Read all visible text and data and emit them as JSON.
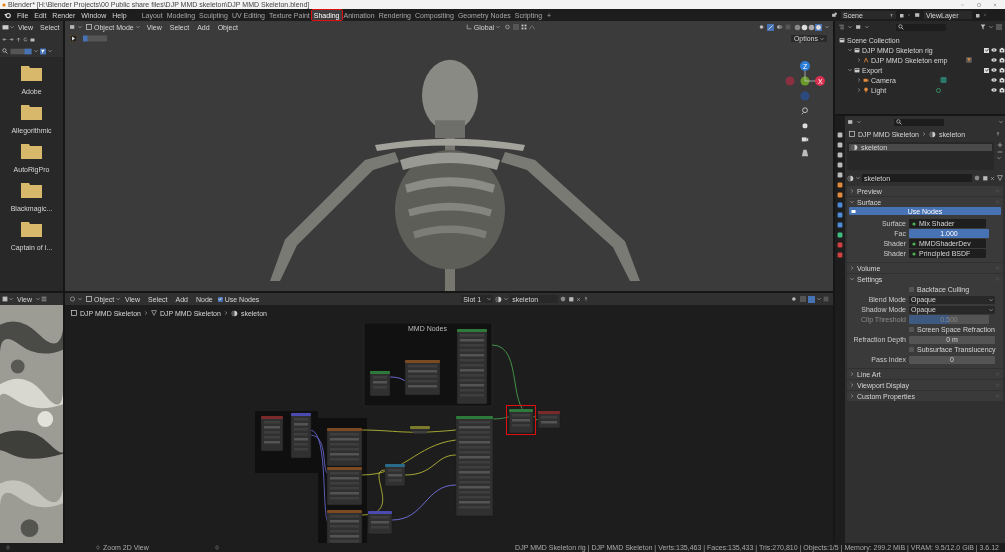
{
  "window": {
    "title": "Blender* [H:\\Blender Projects\\00 Public share files\\DJP MMD skeleton\\DJP MMD Skeleton.blend]"
  },
  "top_bar": {
    "menu": [
      "File",
      "Edit",
      "Render",
      "Window",
      "Help"
    ],
    "workspaces": [
      {
        "label": "Layout",
        "selected": false,
        "annotated": false
      },
      {
        "label": "Modeling",
        "selected": false,
        "annotated": false
      },
      {
        "label": "Sculpting",
        "selected": false,
        "annotated": false
      },
      {
        "label": "UV Editing",
        "selected": false,
        "annotated": false
      },
      {
        "label": "Texture Paint",
        "selected": false,
        "annotated": false
      },
      {
        "label": "Shading",
        "selected": true,
        "annotated": true
      },
      {
        "label": "Animation",
        "selected": false,
        "annotated": false
      },
      {
        "label": "Rendering",
        "selected": false,
        "annotated": false
      },
      {
        "label": "Compositing",
        "selected": false,
        "annotated": false
      },
      {
        "label": "Geometry Nodes",
        "selected": false,
        "annotated": false
      },
      {
        "label": "Scripting",
        "selected": false,
        "annotated": false
      }
    ],
    "add_tab": "+",
    "scene": "Scene",
    "view_layer": "ViewLayer"
  },
  "file_browser": {
    "menu": [
      "View",
      "Select"
    ],
    "folders": [
      "Adobe",
      "Allegorithmic",
      "AutoRigPro",
      "Blackmagic...",
      "Captain of I..."
    ]
  },
  "image_editor": {
    "menu": [
      "View"
    ]
  },
  "viewport": {
    "mode": "Object Mode",
    "menu": [
      "View",
      "Select",
      "Add",
      "Object"
    ],
    "orientation": "Global",
    "options": "Options",
    "gizmo": [
      "Z",
      "X"
    ]
  },
  "outliner": {
    "tree": [
      {
        "label": "Scene Collection",
        "kind": "scene",
        "children": [
          {
            "label": "DJP MMD Skeleton rig",
            "kind": "collection",
            "expanded": true,
            "checked": true,
            "children": [
              {
                "label": "DJP MMD Skeleton emp",
                "kind": "armature",
                "expanded": false
              }
            ]
          },
          {
            "label": "Export",
            "kind": "collection",
            "expanded": true,
            "checked": true,
            "children": [
              {
                "label": "Camera",
                "kind": "camera",
                "expanded": false
              },
              {
                "label": "Light",
                "kind": "light",
                "expanded": false
              }
            ]
          }
        ]
      }
    ]
  },
  "properties": {
    "breadcrumb": [
      "DJP MMD Skeleton",
      "skeleton"
    ],
    "slots": [
      {
        "label": "skeleton",
        "selected": true
      }
    ],
    "material": "skeleton",
    "panels": [
      {
        "title": "Preview",
        "expanded": false
      },
      {
        "title": "Surface",
        "expanded": true,
        "button": "Use Nodes",
        "rows": [
          {
            "kind": "socket",
            "label": "Surface",
            "value": "Mix Shader"
          },
          {
            "kind": "slider",
            "label": "Fac",
            "value": "1.000",
            "level": 1,
            "disabled": false
          },
          {
            "kind": "socket",
            "label": "Shader",
            "value": "MMDShaderDev"
          },
          {
            "kind": "socket",
            "label": "Shader",
            "value": "Principled BSDF"
          }
        ]
      },
      {
        "title": "Volume",
        "expanded": false
      },
      {
        "title": "Settings",
        "expanded": true,
        "rows": [
          {
            "kind": "checkbox",
            "label": "Backface Culling",
            "checked": false
          },
          {
            "kind": "dropdown",
            "label": "Blend Mode",
            "value": "Opaque"
          },
          {
            "kind": "dropdown",
            "label": "Shadow Mode",
            "value": "Opaque"
          },
          {
            "kind": "slider",
            "label": "Clip Threshold",
            "value": "0.500",
            "level": 0.5,
            "disabled": true
          },
          {
            "kind": "checkbox",
            "label": "Screen Space Refraction",
            "checked": false
          },
          {
            "kind": "number",
            "label": "Refraction Depth",
            "value": "0 m"
          },
          {
            "kind": "checkbox",
            "label": "Subsurface Translucency",
            "checked": false
          },
          {
            "kind": "number",
            "label": "Pass Index",
            "value": "0"
          }
        ]
      },
      {
        "title": "Line Art",
        "expanded": false
      },
      {
        "title": "Viewport Display",
        "expanded": false
      },
      {
        "title": "Custom Properties",
        "expanded": false
      }
    ]
  },
  "node_editor": {
    "mode": "Object",
    "menu": [
      "View",
      "Select",
      "Add",
      "Node"
    ],
    "use_nodes": {
      "label": "Use Nodes",
      "checked": true
    },
    "slot": "Slot 1",
    "material": "skeleton",
    "breadcrumb": [
      "DJP MMD Skeleton",
      "DJP MMD Skeleton",
      "skeleton"
    ],
    "frame_title": "MMD Nodes",
    "highlight_box": true
  },
  "status_bar": {
    "hint": "Zoom 2D View",
    "stats": "DJP MMD Skeleton rig | DJP MMD Skeleton | Verts:135,463 | Faces:135,433 | Tris:270,810 | Objects:1/5 | Memory: 299.2 MiB | VRAM: 9.5/12.0 GiB | 3.6.12"
  }
}
